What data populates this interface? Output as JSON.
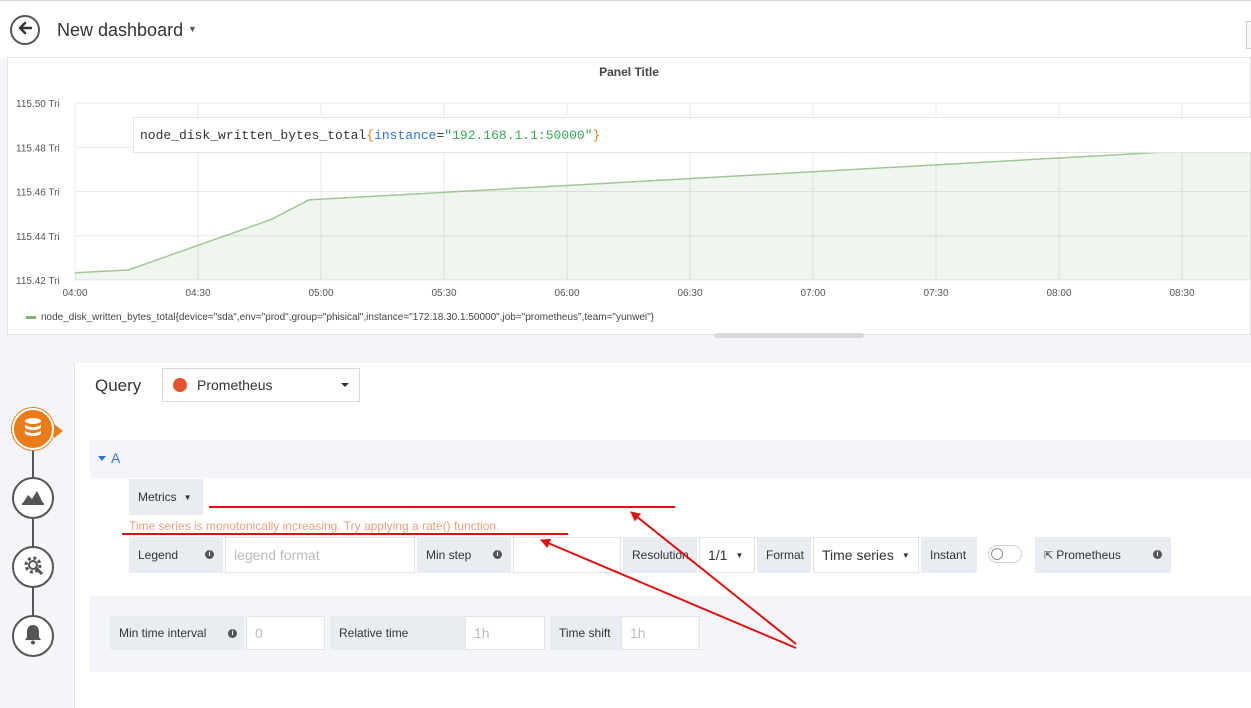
{
  "header": {
    "title": "New dashboard",
    "back_icon": "arrow-left-icon"
  },
  "panel": {
    "title": "Panel Title",
    "legend_label": "node_disk_written_bytes_total{device=\"sda\",env=\"prod\",group=\"phisical\",instance=\"172.18.30.1:50000\",job=\"prometheus\",team=\"yunwei\"}",
    "series_color": "#7eb26d"
  },
  "chart_data": {
    "type": "area",
    "y_unit": "Tri",
    "y_ticks": [
      "115.50 Tri",
      "115.48 Tri",
      "115.46 Tri",
      "115.44 Tri",
      "115.42 Tri"
    ],
    "x_ticks": [
      "04:00",
      "04:30",
      "05:00",
      "05:30",
      "06:00",
      "06:30",
      "07:00",
      "07:30",
      "08:00",
      "08:30"
    ],
    "ylim": [
      115.42,
      115.5
    ],
    "grid": true,
    "legend_position": "bottom-left",
    "series": [
      {
        "name": "node_disk_written_bytes_total{device=\"sda\",env=\"prod\",group=\"phisical\",instance=\"172.18.30.1:50000\",job=\"prometheus\",team=\"yunwei\"}",
        "points": [
          [
            "04:00",
            115.4233
          ],
          [
            "04:13",
            115.4245
          ],
          [
            "04:48",
            115.4475
          ],
          [
            "04:57",
            115.4562
          ],
          [
            "08:47",
            115.48
          ]
        ]
      }
    ]
  },
  "sidebar": {
    "icons": [
      "database-icon",
      "chart-area-icon",
      "gear-icon",
      "bell-icon"
    ],
    "active_color": "#eb7b18"
  },
  "query": {
    "label": "Query",
    "datasource": "Prometheus",
    "ref_id": "A",
    "metrics_label": "Metrics",
    "expr_metric": "node_disk_written_bytes_total",
    "expr_open": "{",
    "expr_key": "instance",
    "expr_eq": "=",
    "expr_value": "\"192.168.1.1:50000\"",
    "expr_close": "}",
    "warning": "Time series is monotonically increasing. Try applying a rate() function.",
    "legend_label": "Legend",
    "legend_placeholder": "legend format",
    "min_step_label": "Min step",
    "resolution_label": "Resolution",
    "resolution_value": "1/1",
    "format_label": "Format",
    "format_value": "Time series",
    "instant_label": "Instant",
    "prometheus_link": "Prometheus"
  },
  "options": {
    "min_interval_label": "Min time interval",
    "min_interval_placeholder": "0",
    "relative_time_label": "Relative time",
    "relative_time_placeholder": "1h",
    "time_shift_label": "Time shift",
    "time_shift_placeholder": "1h"
  },
  "annotation_color": "#e01010"
}
